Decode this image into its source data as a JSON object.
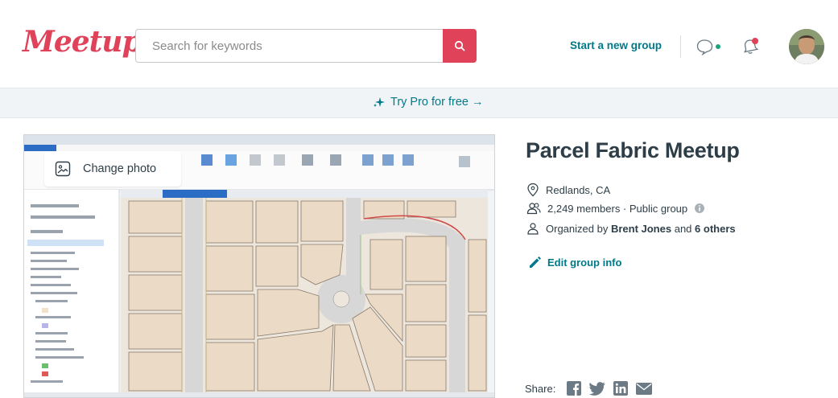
{
  "header": {
    "logo": "Meetup",
    "search_placeholder": "Search for keywords",
    "start_group": "Start a new group"
  },
  "pro_banner": {
    "text": "Try Pro for free →"
  },
  "photo": {
    "change_label": "Change photo"
  },
  "group": {
    "title": "Parcel Fabric Meetup",
    "location": "Redlands, CA",
    "members": "2,249 members · Public group",
    "organized_prefix": "Organized by",
    "organizer": "Brent Jones",
    "organized_and": "and",
    "others": "6 others",
    "edit_label": "Edit group info"
  },
  "share": {
    "label": "Share:",
    "icons": [
      "facebook-icon",
      "twitter-icon",
      "linkedin-icon",
      "email-icon"
    ]
  },
  "colors": {
    "brand": "#e0425a",
    "link": "#00798a",
    "text": "#2e3e48"
  }
}
